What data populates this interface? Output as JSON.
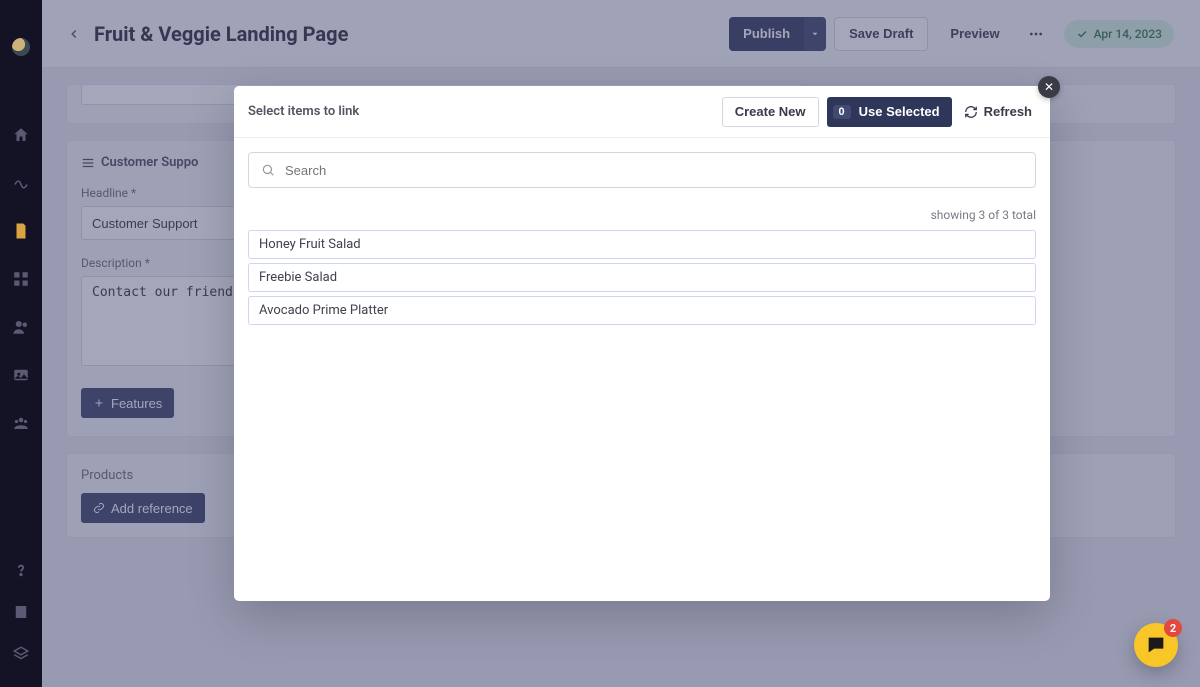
{
  "page": {
    "title": "Fruit & Veggie Landing Page",
    "status_date": "Apr 14, 2023"
  },
  "toolbar": {
    "publish": "Publish",
    "save_draft": "Save Draft",
    "preview": "Preview"
  },
  "panel": {
    "section_title": "Customer Suppo",
    "headline_label": "Headline *",
    "headline_value": "Customer Support",
    "description_label": "Description *",
    "description_value": "Contact our friend",
    "features_btn": "Features",
    "products_label": "Products",
    "add_reference": "Add reference"
  },
  "modal": {
    "title": "Select items to link",
    "create_new": "Create New",
    "use_selected": "Use Selected",
    "selected_count": "0",
    "refresh": "Refresh",
    "search_placeholder": "Search",
    "result_count": "showing 3 of 3 total",
    "items": [
      "Honey Fruit Salad",
      "Freebie Salad",
      "Avocado Prime Platter"
    ]
  },
  "chat": {
    "badge": "2"
  }
}
